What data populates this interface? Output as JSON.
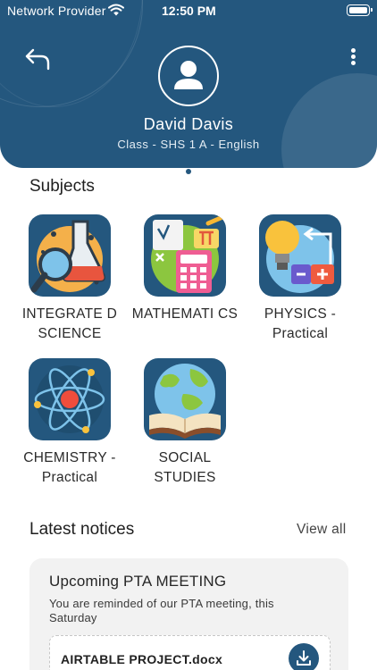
{
  "status_bar": {
    "carrier": "Network Provider",
    "time": "12:50 PM"
  },
  "profile": {
    "name": "David Davis",
    "class_line": "Class - SHS 1 A - English"
  },
  "subjects": {
    "title": "Subjects",
    "items": [
      {
        "label": "INTEGRATE D SCIENCE",
        "icon": "science-flask-magnifier-icon"
      },
      {
        "label": "MATHEMATI CS",
        "icon": "math-calculator-icon"
      },
      {
        "label": "PHYSICS - Practical",
        "icon": "physics-lightbulb-circuit-icon"
      },
      {
        "label": "CHEMISTRY - Practical",
        "icon": "chemistry-atom-icon"
      },
      {
        "label": "SOCIAL STUDIES",
        "icon": "globe-book-icon"
      }
    ]
  },
  "notices": {
    "title": "Latest notices",
    "view_all": "View all",
    "items": [
      {
        "title": "Upcoming PTA MEETING",
        "body": "You are reminded of our PTA meeting, this Saturday",
        "attachment": "AIRTABLE PROJECT.docx"
      }
    ]
  },
  "colors": {
    "primary": "#24577e",
    "card": "#f2f2f2"
  }
}
